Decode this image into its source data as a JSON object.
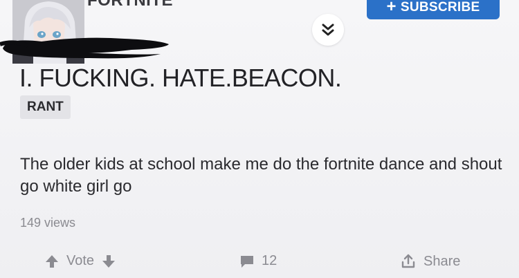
{
  "header": {
    "community_name": "FORTNITE",
    "subscribe_label": "SUBSCRIBE",
    "subscribe_icon": "plus-icon",
    "collapse_icon": "double-chevron-down-icon"
  },
  "post": {
    "title": "I. FUCKING. HATE.BEACON.",
    "tag": "RANT",
    "body": "The older kids at school make me do the fortnite dance and shout go white girl  go",
    "views": "149 views"
  },
  "actions": {
    "vote_label": "Vote",
    "comment_count": "12",
    "share_label": "Share"
  },
  "colors": {
    "accent": "#2b71c8",
    "muted": "#8b8b91",
    "background": "#f4f4f6"
  }
}
